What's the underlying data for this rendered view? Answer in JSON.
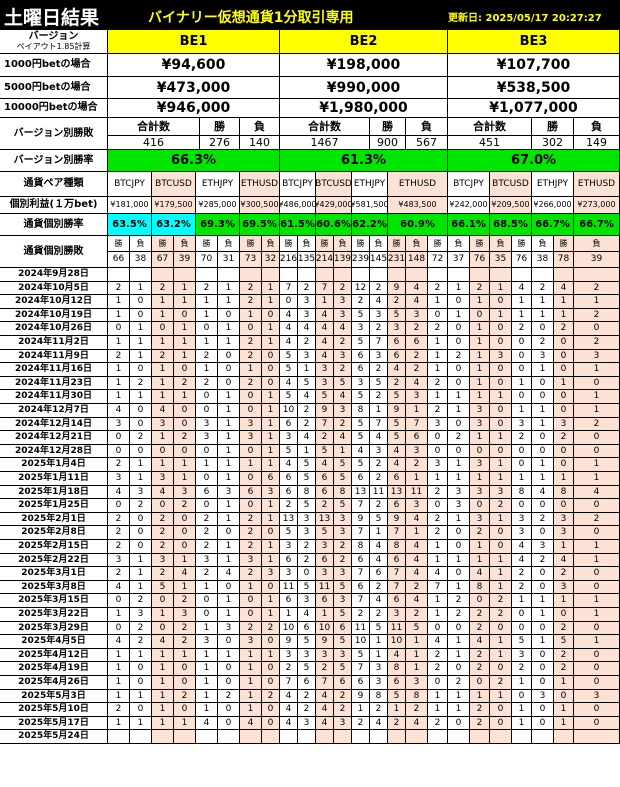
{
  "header": {
    "title": "土曜日結果",
    "subtitle": "バイナリー仮想通貨1分取引専用",
    "updated": "更新日: 2025/05/17 20:27:27"
  },
  "version_label": "バージョン",
  "payout_label": "ペイアウト1.85計算",
  "versions": [
    "BE1",
    "BE2",
    "BE3"
  ],
  "bet_rows": [
    {
      "label": "1000円betの場合",
      "values": [
        "¥94,600",
        "¥198,000",
        "¥107,700"
      ]
    },
    {
      "label": "5000円betの場合",
      "values": [
        "¥473,000",
        "¥990,000",
        "¥538,500"
      ]
    },
    {
      "label": "10000円betの場合",
      "values": [
        "¥946,000",
        "¥1,980,000",
        "¥1,077,000"
      ]
    }
  ],
  "wl_label": "バージョン別勝敗",
  "wl_headers": {
    "total": "合計数",
    "win": "勝",
    "lose": "負"
  },
  "wl_values": [
    [
      "416",
      "276",
      "140"
    ],
    [
      "1467",
      "900",
      "567"
    ],
    [
      "451",
      "302",
      "149"
    ]
  ],
  "rate_label": "バージョン別勝率",
  "rates": [
    "66.3%",
    "61.3%",
    "67.0%"
  ],
  "pair_label": "通貨ペア種類",
  "pairs": [
    "BTCJPY",
    "BTCUSD",
    "ETHJPY",
    "ETHUSD"
  ],
  "profit_label": "個別利益(１万bet)",
  "profits": [
    "¥181,000",
    "¥179,500",
    "¥285,000",
    "¥300,500",
    "¥486,000",
    "¥429,000",
    "¥581,500",
    "¥483,500",
    "¥242,000",
    "¥209,500",
    "¥266,000",
    "¥273,000"
  ],
  "pair_rate_label": "通貨個別勝率",
  "pair_rates": [
    "63.5%",
    "63.2%",
    "69.3%",
    "69.5%",
    "61.5%",
    "60.6%",
    "62.2%",
    "60.9%",
    "66.1%",
    "68.5%",
    "66.7%",
    "66.7%"
  ],
  "pair_wl_label": "通貨個別勝敗",
  "win_short": "勝",
  "lose_short": "負",
  "pair_wl_totals": [
    "66",
    "38",
    "67",
    "39",
    "70",
    "31",
    "73",
    "32",
    "216",
    "135",
    "214",
    "139",
    "239",
    "145",
    "231",
    "148",
    "72",
    "37",
    "76",
    "35",
    "76",
    "38",
    "78",
    "39"
  ],
  "colors": {
    "yellow": "#ffff00",
    "green": "#00e600",
    "cyan": "#00ffff",
    "pink": "#fbe2d5",
    "header": "#000000"
  },
  "rows": [
    {
      "date": "2024年9月28日",
      "v": [
        "",
        "",
        "",
        "",
        "",
        "",
        "",
        "",
        "",
        "",
        "",
        "",
        "",
        "",
        "",
        "",
        "",
        "",
        "",
        "",
        "",
        "",
        "",
        ""
      ]
    },
    {
      "date": "2024年10月5日",
      "v": [
        "2",
        "1",
        "2",
        "1",
        "2",
        "1",
        "2",
        "1",
        "7",
        "2",
        "7",
        "2",
        "12",
        "2",
        "9",
        "4",
        "2",
        "1",
        "2",
        "1",
        "4",
        "2",
        "4",
        "2"
      ]
    },
    {
      "date": "2024年10月12日",
      "v": [
        "1",
        "0",
        "1",
        "1",
        "1",
        "1",
        "2",
        "1",
        "0",
        "3",
        "1",
        "3",
        "2",
        "4",
        "2",
        "4",
        "1",
        "0",
        "1",
        "0",
        "1",
        "1",
        "1",
        "1"
      ]
    },
    {
      "date": "2024年10月19日",
      "v": [
        "1",
        "0",
        "1",
        "0",
        "1",
        "0",
        "1",
        "0",
        "4",
        "3",
        "4",
        "3",
        "5",
        "3",
        "5",
        "3",
        "0",
        "1",
        "0",
        "1",
        "1",
        "1",
        "1",
        "2"
      ]
    },
    {
      "date": "2024年10月26日",
      "v": [
        "0",
        "1",
        "0",
        "1",
        "0",
        "1",
        "0",
        "1",
        "4",
        "4",
        "4",
        "4",
        "3",
        "2",
        "3",
        "2",
        "2",
        "0",
        "1",
        "0",
        "2",
        "0",
        "2",
        "0"
      ]
    },
    {
      "date": "2024年11月2日",
      "v": [
        "1",
        "1",
        "1",
        "1",
        "1",
        "1",
        "2",
        "1",
        "4",
        "2",
        "4",
        "2",
        "5",
        "7",
        "6",
        "6",
        "1",
        "0",
        "1",
        "0",
        "0",
        "2",
        "0",
        "2"
      ]
    },
    {
      "date": "2024年11月9日",
      "v": [
        "2",
        "1",
        "2",
        "1",
        "2",
        "0",
        "2",
        "0",
        "5",
        "3",
        "4",
        "3",
        "6",
        "3",
        "6",
        "2",
        "1",
        "2",
        "1",
        "3",
        "0",
        "3",
        "0",
        "3"
      ]
    },
    {
      "date": "2024年11月16日",
      "v": [
        "1",
        "0",
        "1",
        "0",
        "1",
        "0",
        "1",
        "0",
        "5",
        "1",
        "3",
        "2",
        "6",
        "2",
        "4",
        "2",
        "1",
        "0",
        "1",
        "0",
        "0",
        "1",
        "0",
        "1"
      ]
    },
    {
      "date": "2024年11月23日",
      "v": [
        "1",
        "2",
        "1",
        "2",
        "2",
        "0",
        "2",
        "0",
        "4",
        "5",
        "3",
        "5",
        "3",
        "5",
        "2",
        "4",
        "2",
        "0",
        "1",
        "0",
        "1",
        "0",
        "1",
        "0"
      ]
    },
    {
      "date": "2024年11月30日",
      "v": [
        "1",
        "1",
        "1",
        "1",
        "0",
        "1",
        "0",
        "1",
        "5",
        "4",
        "5",
        "4",
        "5",
        "2",
        "5",
        "3",
        "1",
        "1",
        "1",
        "1",
        "0",
        "0",
        "0",
        "1"
      ]
    },
    {
      "date": "2024年12月7日",
      "v": [
        "4",
        "0",
        "4",
        "0",
        "0",
        "1",
        "0",
        "1",
        "10",
        "2",
        "9",
        "3",
        "8",
        "1",
        "9",
        "1",
        "2",
        "1",
        "3",
        "0",
        "1",
        "1",
        "0",
        "1"
      ]
    },
    {
      "date": "2024年12月14日",
      "v": [
        "3",
        "0",
        "3",
        "0",
        "3",
        "1",
        "3",
        "1",
        "6",
        "2",
        "7",
        "2",
        "5",
        "7",
        "5",
        "7",
        "3",
        "0",
        "3",
        "0",
        "3",
        "1",
        "3",
        "2"
      ]
    },
    {
      "date": "2024年12月21日",
      "v": [
        "0",
        "2",
        "1",
        "2",
        "3",
        "1",
        "3",
        "1",
        "3",
        "4",
        "2",
        "4",
        "5",
        "4",
        "5",
        "6",
        "0",
        "2",
        "1",
        "1",
        "2",
        "0",
        "2",
        "0"
      ]
    },
    {
      "date": "2024年12月28日",
      "v": [
        "0",
        "0",
        "0",
        "0",
        "0",
        "1",
        "0",
        "1",
        "5",
        "1",
        "5",
        "1",
        "4",
        "3",
        "4",
        "3",
        "0",
        "0",
        "0",
        "0",
        "0",
        "0",
        "0",
        "0"
      ]
    },
    {
      "date": "2025年1月4日",
      "v": [
        "2",
        "1",
        "1",
        "1",
        "1",
        "1",
        "1",
        "1",
        "4",
        "5",
        "4",
        "5",
        "5",
        "2",
        "4",
        "2",
        "3",
        "1",
        "3",
        "1",
        "0",
        "1",
        "0",
        "1"
      ]
    },
    {
      "date": "2025年1月11日",
      "v": [
        "3",
        "1",
        "3",
        "1",
        "0",
        "1",
        "0",
        "6",
        "6",
        "5",
        "6",
        "5",
        "6",
        "2",
        "6",
        "1",
        "1",
        "1",
        "1",
        "1",
        "1",
        "1",
        "1",
        "1"
      ]
    },
    {
      "date": "2025年1月18日",
      "v": [
        "4",
        "3",
        "4",
        "3",
        "6",
        "3",
        "6",
        "3",
        "6",
        "8",
        "6",
        "8",
        "13",
        "11",
        "13",
        "11",
        "2",
        "3",
        "3",
        "3",
        "8",
        "4",
        "8",
        "4"
      ]
    },
    {
      "date": "2025年1月25日",
      "v": [
        "0",
        "2",
        "0",
        "2",
        "0",
        "1",
        "0",
        "1",
        "2",
        "5",
        "2",
        "5",
        "7",
        "2",
        "6",
        "3",
        "0",
        "3",
        "0",
        "2",
        "0",
        "0",
        "0",
        "0"
      ]
    },
    {
      "date": "2025年2月1日",
      "v": [
        "2",
        "0",
        "2",
        "0",
        "2",
        "1",
        "2",
        "1",
        "13",
        "3",
        "13",
        "3",
        "9",
        "5",
        "9",
        "4",
        "2",
        "1",
        "3",
        "1",
        "3",
        "2",
        "3",
        "2"
      ]
    },
    {
      "date": "2025年2月8日",
      "v": [
        "2",
        "0",
        "2",
        "0",
        "2",
        "0",
        "2",
        "0",
        "5",
        "3",
        "5",
        "3",
        "7",
        "1",
        "7",
        "1",
        "2",
        "0",
        "2",
        "0",
        "3",
        "0",
        "3",
        "0"
      ]
    },
    {
      "date": "2025年2月15日",
      "v": [
        "2",
        "0",
        "2",
        "0",
        "2",
        "1",
        "2",
        "1",
        "3",
        "2",
        "3",
        "2",
        "8",
        "4",
        "8",
        "4",
        "1",
        "0",
        "1",
        "0",
        "4",
        "3",
        "1",
        "1"
      ]
    },
    {
      "date": "2025年2月22日",
      "v": [
        "3",
        "1",
        "3",
        "1",
        "3",
        "1",
        "3",
        "1",
        "6",
        "2",
        "6",
        "2",
        "6",
        "4",
        "6",
        "4",
        "1",
        "1",
        "1",
        "1",
        "4",
        "2",
        "4",
        "1"
      ]
    },
    {
      "date": "2025年3月1日",
      "v": [
        "2",
        "1",
        "2",
        "4",
        "2",
        "4",
        "2",
        "3",
        "3",
        "0",
        "3",
        "3",
        "7",
        "6",
        "7",
        "4",
        "4",
        "0",
        "4",
        "1",
        "2",
        "0",
        "2",
        "0"
      ]
    },
    {
      "date": "2025年3月8日",
      "v": [
        "4",
        "1",
        "5",
        "1",
        "1",
        "0",
        "1",
        "0",
        "11",
        "5",
        "11",
        "5",
        "6",
        "2",
        "7",
        "2",
        "7",
        "1",
        "8",
        "1",
        "2",
        "0",
        "3",
        "0"
      ]
    },
    {
      "date": "2025年3月15日",
      "v": [
        "0",
        "2",
        "0",
        "2",
        "0",
        "1",
        "0",
        "1",
        "6",
        "3",
        "6",
        "3",
        "7",
        "4",
        "6",
        "4",
        "1",
        "2",
        "0",
        "2",
        "1",
        "1",
        "1",
        "1"
      ]
    },
    {
      "date": "2025年3月22日",
      "v": [
        "1",
        "3",
        "1",
        "3",
        "0",
        "1",
        "0",
        "1",
        "1",
        "4",
        "1",
        "5",
        "2",
        "2",
        "3",
        "2",
        "1",
        "2",
        "2",
        "2",
        "0",
        "1",
        "0",
        "1"
      ]
    },
    {
      "date": "2025年3月29日",
      "v": [
        "0",
        "2",
        "0",
        "2",
        "1",
        "3",
        "2",
        "2",
        "10",
        "6",
        "10",
        "6",
        "11",
        "5",
        "11",
        "5",
        "0",
        "0",
        "2",
        "0",
        "0",
        "0",
        "2",
        "0"
      ]
    },
    {
      "date": "2025年4月5日",
      "v": [
        "4",
        "2",
        "4",
        "2",
        "3",
        "0",
        "3",
        "0",
        "9",
        "5",
        "9",
        "5",
        "10",
        "1",
        "10",
        "1",
        "4",
        "1",
        "4",
        "1",
        "5",
        "1",
        "5",
        "1"
      ]
    },
    {
      "date": "2025年4月12日",
      "v": [
        "1",
        "1",
        "1",
        "1",
        "1",
        "1",
        "1",
        "1",
        "3",
        "3",
        "3",
        "3",
        "5",
        "1",
        "4",
        "1",
        "2",
        "1",
        "2",
        "1",
        "3",
        "0",
        "2",
        "0"
      ]
    },
    {
      "date": "2025年4月19日",
      "v": [
        "1",
        "0",
        "1",
        "0",
        "1",
        "0",
        "1",
        "0",
        "2",
        "5",
        "2",
        "5",
        "7",
        "3",
        "8",
        "1",
        "2",
        "0",
        "2",
        "0",
        "2",
        "0",
        "2",
        "0"
      ]
    },
    {
      "date": "2025年4月26日",
      "v": [
        "1",
        "0",
        "1",
        "0",
        "1",
        "0",
        "1",
        "0",
        "7",
        "6",
        "7",
        "6",
        "6",
        "3",
        "6",
        "3",
        "0",
        "2",
        "0",
        "2",
        "1",
        "0",
        "1",
        "0"
      ]
    },
    {
      "date": "2025年5月3日",
      "v": [
        "1",
        "1",
        "1",
        "2",
        "1",
        "2",
        "1",
        "2",
        "4",
        "2",
        "4",
        "2",
        "9",
        "8",
        "5",
        "8",
        "1",
        "1",
        "1",
        "1",
        "0",
        "3",
        "0",
        "3"
      ]
    },
    {
      "date": "2025年5月10日",
      "v": [
        "2",
        "0",
        "1",
        "0",
        "1",
        "0",
        "1",
        "0",
        "4",
        "2",
        "4",
        "2",
        "1",
        "2",
        "1",
        "2",
        "1",
        "1",
        "2",
        "0",
        "1",
        "0",
        "1",
        "0"
      ]
    },
    {
      "date": "2025年5月17日",
      "v": [
        "1",
        "1",
        "1",
        "1",
        "4",
        "0",
        "4",
        "0",
        "4",
        "3",
        "4",
        "3",
        "2",
        "4",
        "2",
        "4",
        "2",
        "0",
        "2",
        "0",
        "1",
        "0",
        "1",
        "0"
      ]
    },
    {
      "date": "2025年5月24日",
      "v": [
        "",
        "",
        "",
        "",
        "",
        "",
        "",
        "",
        "",
        "",
        "",
        "",
        "",
        "",
        "",
        "",
        "",
        "",
        "",
        "",
        "",
        "",
        "",
        ""
      ]
    }
  ]
}
